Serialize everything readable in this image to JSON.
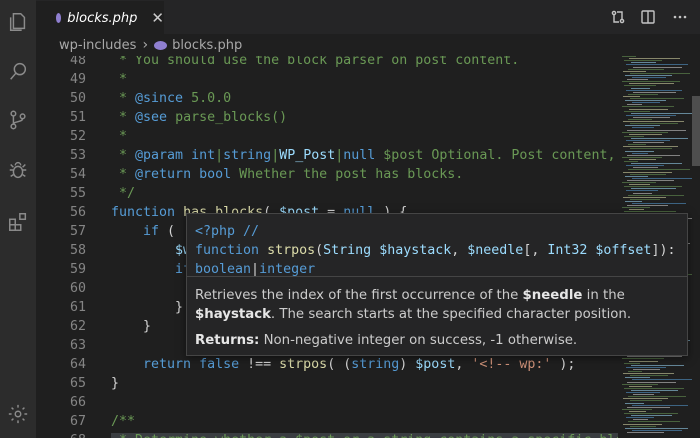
{
  "tab": {
    "filename": "blocks.php",
    "close_glyph": "✕"
  },
  "breadcrumbs": {
    "folder": "wp-includes",
    "file": "blocks.php",
    "separator": "›"
  },
  "editor": {
    "lines": [
      {
        "n": "48",
        "t": [
          [
            "c",
            " * You should use the block parser on post content."
          ]
        ]
      },
      {
        "n": "49",
        "t": [
          [
            "c",
            " *"
          ]
        ]
      },
      {
        "n": "50",
        "t": [
          [
            "c",
            " * "
          ],
          [
            "k",
            "@since"
          ],
          [
            "c",
            " 5.0.0"
          ]
        ]
      },
      {
        "n": "51",
        "t": [
          [
            "c",
            " * "
          ],
          [
            "k",
            "@see"
          ],
          [
            "c",
            " parse_blocks()"
          ]
        ]
      },
      {
        "n": "52",
        "t": [
          [
            "c",
            " *"
          ]
        ]
      },
      {
        "n": "53",
        "t": [
          [
            "c",
            " * "
          ],
          [
            "k",
            "@param"
          ],
          [
            "c",
            " "
          ],
          [
            "k",
            "int"
          ],
          [
            "c",
            "|"
          ],
          [
            "k",
            "string"
          ],
          [
            "c",
            "|"
          ],
          [
            "v",
            "WP_Post"
          ],
          [
            "c",
            "|"
          ],
          [
            "k",
            "null"
          ],
          [
            "c",
            " $post Optional. Post content, post"
          ]
        ]
      },
      {
        "n": "54",
        "t": [
          [
            "c",
            " * "
          ],
          [
            "k",
            "@return"
          ],
          [
            "c",
            " "
          ],
          [
            "k",
            "bool"
          ],
          [
            "c",
            " Whether the post has blocks."
          ]
        ]
      },
      {
        "n": "55",
        "t": [
          [
            "c",
            " */"
          ]
        ]
      },
      {
        "n": "56",
        "t": [
          [
            "k",
            "function"
          ],
          [
            "p",
            " "
          ],
          [
            "f",
            "has_blocks"
          ],
          [
            "p",
            "( "
          ],
          [
            "v",
            "$post"
          ],
          [
            "p",
            " = "
          ],
          [
            "k",
            "null"
          ],
          [
            "p",
            " ) {"
          ]
        ]
      },
      {
        "n": "57",
        "t": [
          [
            "p",
            "    "
          ],
          [
            "k",
            "if"
          ],
          [
            "p",
            " ( !"
          ]
        ]
      },
      {
        "n": "58",
        "t": [
          [
            "p",
            "        "
          ],
          [
            "v",
            "$w"
          ]
        ]
      },
      {
        "n": "59",
        "t": [
          [
            "p",
            "        "
          ],
          [
            "k",
            "if"
          ]
        ]
      },
      {
        "n": "60",
        "t": [
          [
            "p",
            ""
          ]
        ]
      },
      {
        "n": "61",
        "t": [
          [
            "p",
            "        }"
          ]
        ]
      },
      {
        "n": "62",
        "t": [
          [
            "p",
            "    }"
          ]
        ]
      },
      {
        "n": "63",
        "t": [
          [
            "p",
            ""
          ]
        ]
      },
      {
        "n": "64",
        "t": [
          [
            "p",
            "    "
          ],
          [
            "k",
            "return"
          ],
          [
            "p",
            " "
          ],
          [
            "k",
            "false"
          ],
          [
            "p",
            " !== "
          ],
          [
            "f",
            "strpos"
          ],
          [
            "p",
            "( ("
          ],
          [
            "k",
            "string"
          ],
          [
            "p",
            ") "
          ],
          [
            "v",
            "$post"
          ],
          [
            "p",
            ", "
          ],
          [
            "s",
            "'<!-- wp:'"
          ],
          [
            "p",
            " );"
          ]
        ]
      },
      {
        "n": "65",
        "t": [
          [
            "p",
            "}"
          ]
        ]
      },
      {
        "n": "66",
        "t": [
          [
            "p",
            ""
          ]
        ]
      },
      {
        "n": "67",
        "t": [
          [
            "c",
            "/**"
          ]
        ]
      },
      {
        "n": "68",
        "t": [
          [
            "c",
            " * Determine whether a $post or a string contains a specific block"
          ]
        ]
      }
    ]
  },
  "hover": {
    "signature_parts": [
      [
        "k",
        "<?php //"
      ],
      [
        "nl",
        ""
      ],
      [
        "k",
        "function"
      ],
      [
        "p",
        " "
      ],
      [
        "f",
        "strpos"
      ],
      [
        "p",
        "("
      ],
      [
        "v",
        "String"
      ],
      [
        "p",
        " "
      ],
      [
        "v",
        "$haystack"
      ],
      [
        "p",
        ", "
      ],
      [
        "v",
        "$needle"
      ],
      [
        "p",
        "[, "
      ],
      [
        "v",
        "Int32"
      ],
      [
        "p",
        " "
      ],
      [
        "v",
        "$offset"
      ],
      [
        "p",
        "]): "
      ],
      [
        "k",
        "boolean"
      ],
      [
        "p",
        "|"
      ],
      [
        "k",
        "integer"
      ]
    ],
    "desc_parts": [
      [
        "t",
        "Retrieves the index of the first occurrence of the "
      ],
      [
        "b",
        "$needle"
      ],
      [
        "t",
        " in the "
      ],
      [
        "b",
        "$haystack"
      ],
      [
        "t",
        ". The search starts at the specified character position."
      ]
    ],
    "returns_label": "Returns:",
    "returns_text": " Non-negative integer on success, -1 otherwise."
  },
  "colors": {
    "comment": "#6a9955",
    "keyword": "#569cd6",
    "function": "#dcdcaa",
    "variable": "#9cdcfe",
    "string": "#ce9178"
  },
  "icons": [
    "explorer-icon",
    "search-icon",
    "source-control-icon",
    "debug-icon",
    "extensions-icon",
    "settings-gear-icon",
    "compare-changes-icon",
    "split-editor-icon",
    "more-actions-icon"
  ]
}
